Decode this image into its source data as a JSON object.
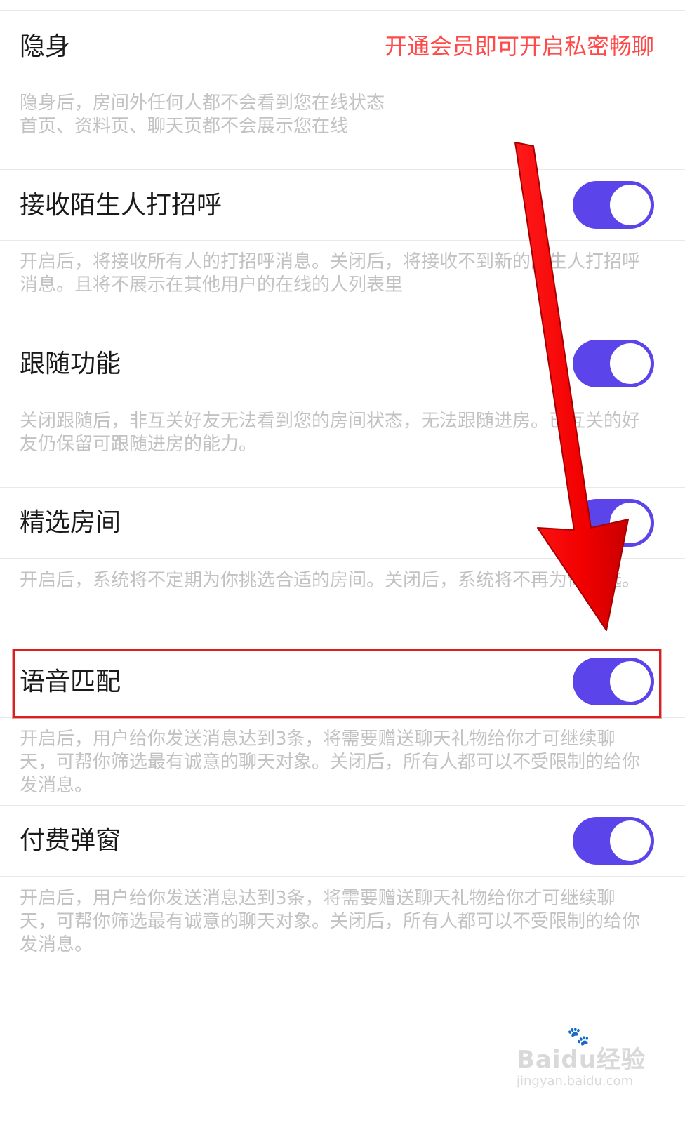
{
  "settings": [
    {
      "key": "stealth",
      "title": "隐身",
      "vip_text": "开通会员即可开启私密畅聊",
      "description": "隐身后，房间外任何人都不会看到您在线状态\n首页、资料页、聊天页都不会展示您在线"
    },
    {
      "key": "stranger-greeting",
      "title": "接收陌生人打招呼",
      "enabled": true,
      "description": "开启后，将接收所有人的打招呼消息。关闭后，将接收不到新的陌生人打招呼消息。且将不展示在其他用户的在线的人列表里"
    },
    {
      "key": "follow",
      "title": "跟随功能",
      "enabled": true,
      "description": "关闭跟随后，非互关好友无法看到您的房间状态，无法跟随进房。已互关的好友仍保留可跟随进房的能力。"
    },
    {
      "key": "featured-room",
      "title": "精选房间",
      "enabled": true,
      "description": "开启后，系统将不定期为你挑选合适的房间。关闭后，系统将不再为你挑选。"
    },
    {
      "key": "voice-match",
      "title": "语音匹配",
      "enabled": true,
      "description": "开启后，用户给你发送消息达到3条，将需要赠送聊天礼物给你才可继续聊天，可帮你筛选最有诚意的聊天对象。关闭后，所有人都可以不受限制的给你发消息。"
    },
    {
      "key": "paid-popup",
      "title": "付费弹窗",
      "enabled": true,
      "description": "开启后，用户给你发送消息达到3条，将需要赠送聊天礼物给你才可继续聊天，可帮你筛选最有诚意的聊天对象。关闭后，所有人都可以不受限制的给你发消息。"
    }
  ],
  "colors": {
    "toggle_on": "#5b45ea",
    "vip_red": "#ff4a4a",
    "annotation_red": "#e01e1e",
    "description_gray": "#c2c2c2"
  },
  "watermark": {
    "main": "Baidu经验",
    "sub": "jingyan.baidu.com"
  }
}
